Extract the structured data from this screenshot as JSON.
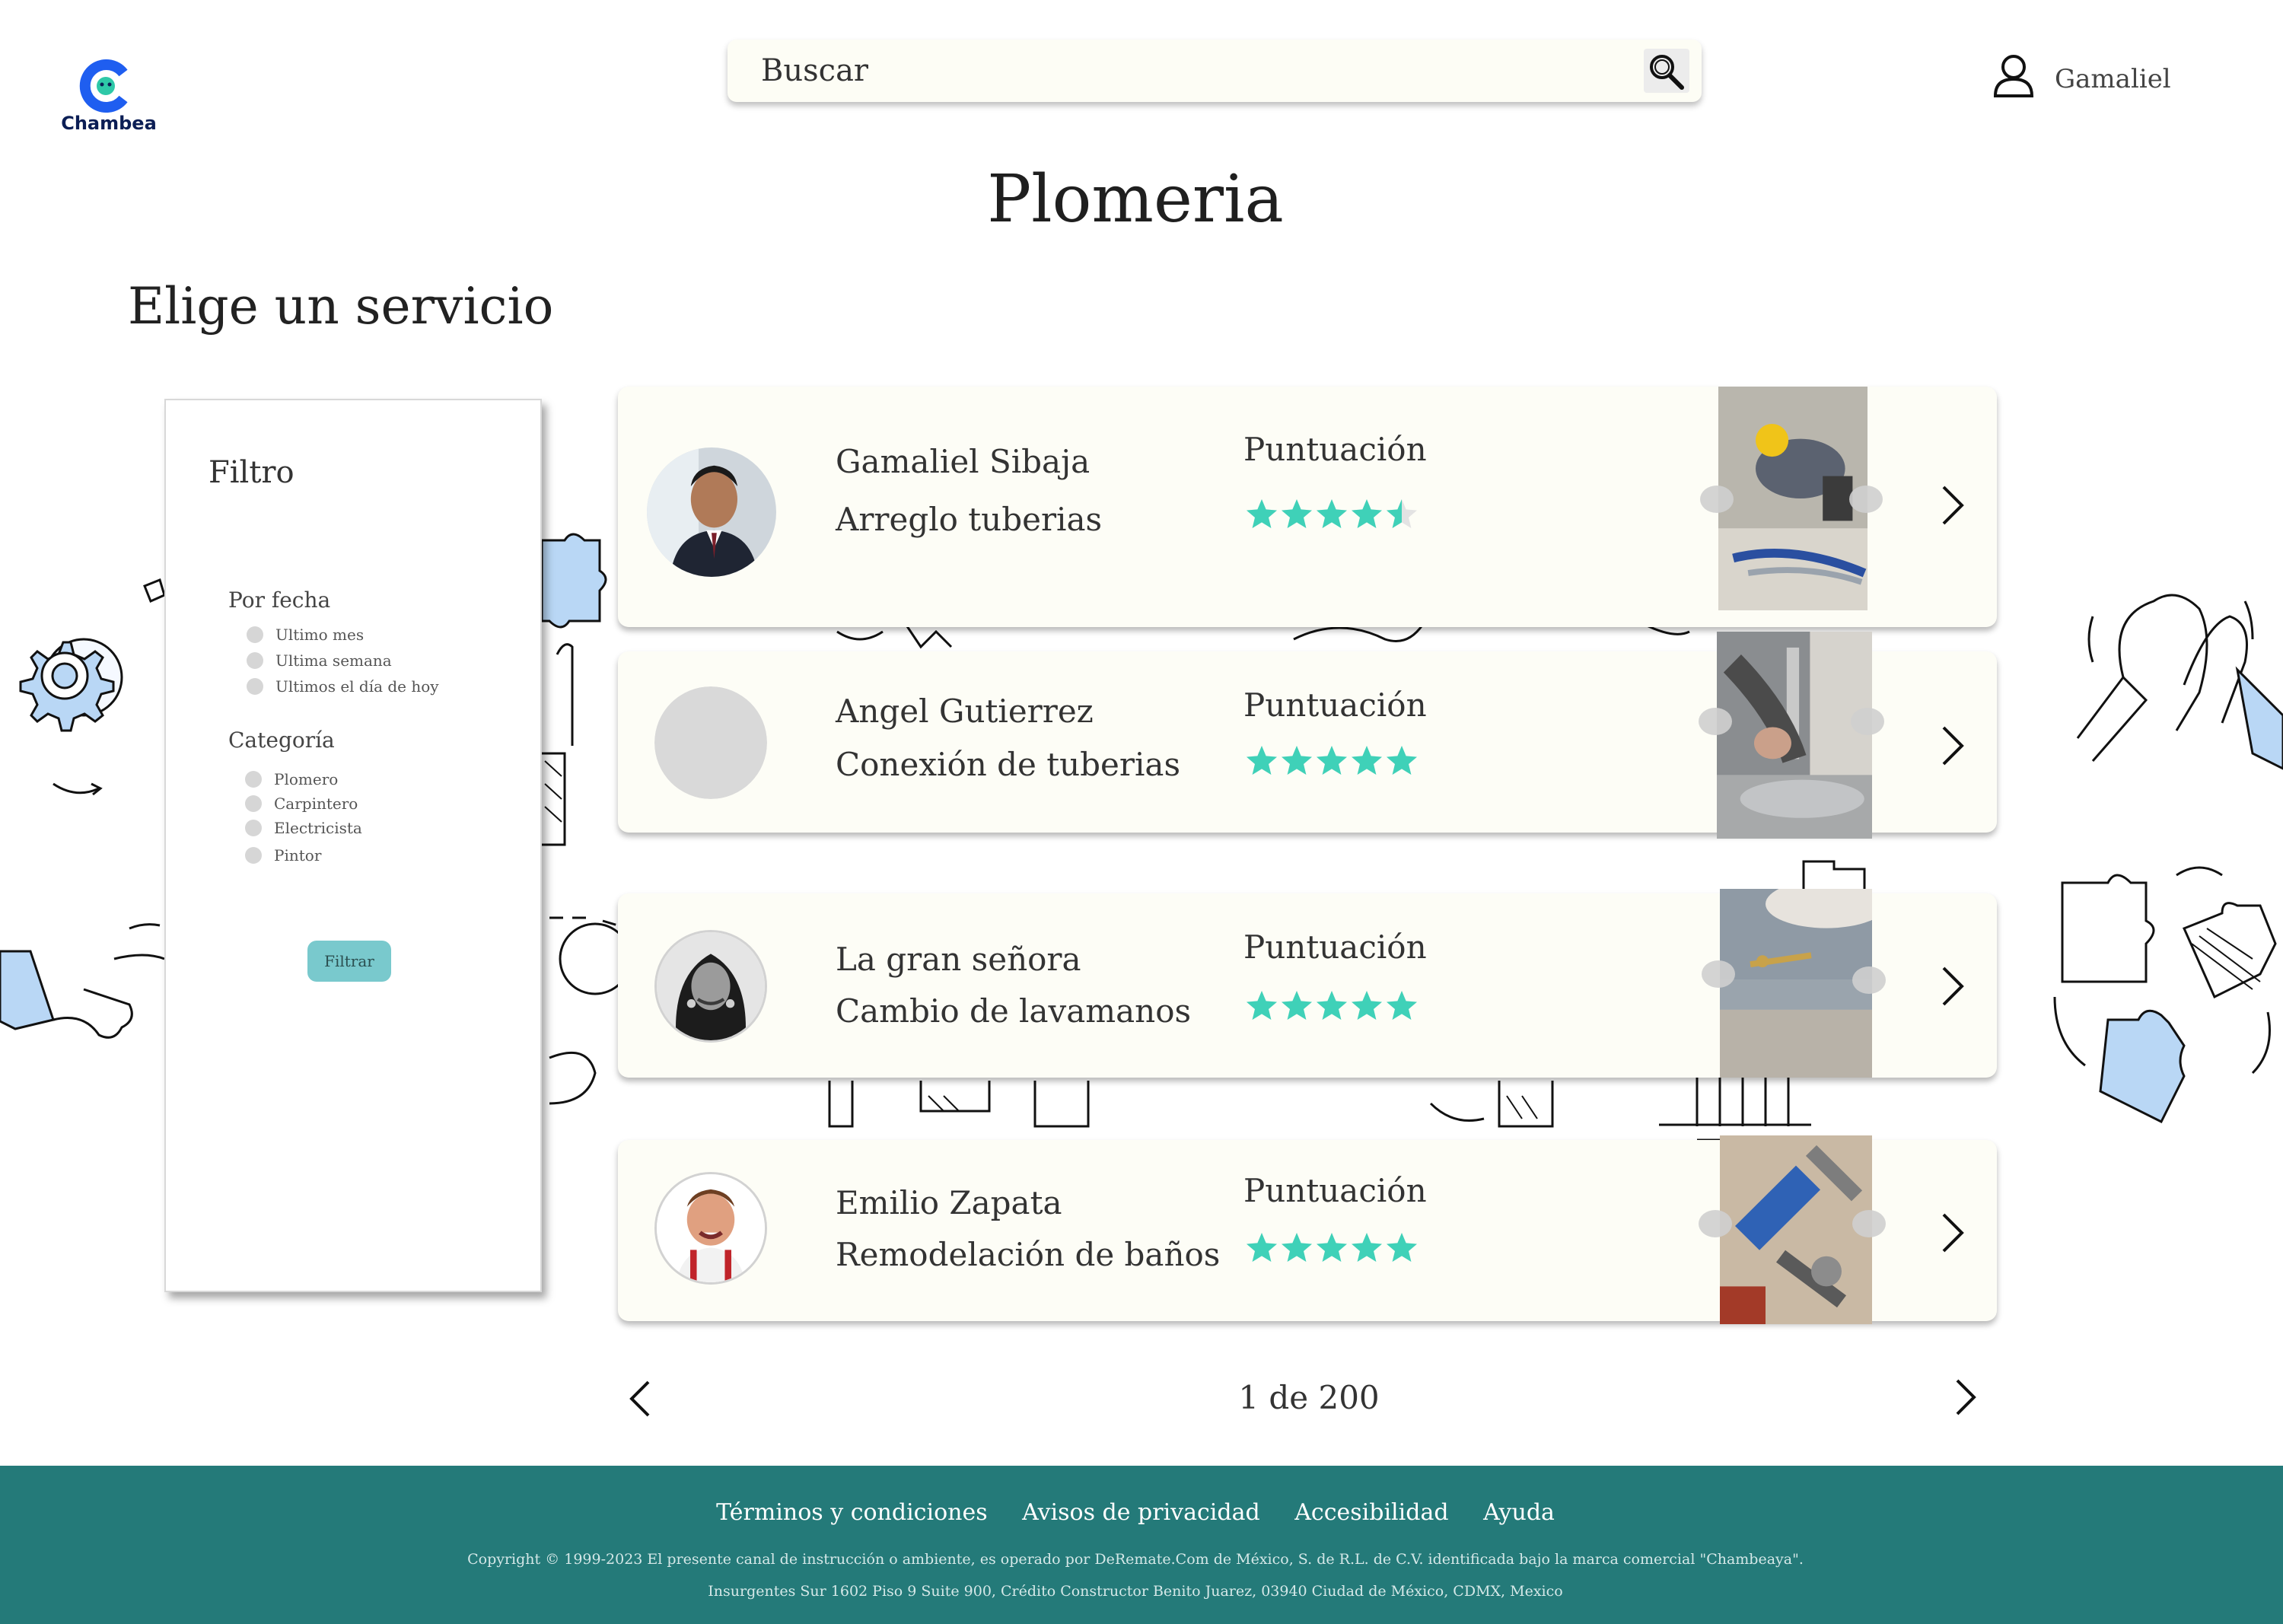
{
  "brand": {
    "logo_text": "Chambea"
  },
  "search": {
    "placeholder": "Buscar"
  },
  "user": {
    "name": "Gamaliel"
  },
  "page": {
    "title": "Plomeria",
    "subtitle": "Elige un servicio"
  },
  "filter": {
    "title": "Filtro",
    "by_date": {
      "label": "Por fecha",
      "options": [
        "Ultimo mes",
        "Ultima semana",
        "Ultimos el día de hoy"
      ]
    },
    "category": {
      "label": "Categoría",
      "options": [
        "Plomero",
        "Carpintero",
        "Electricista",
        "Pintor"
      ]
    },
    "button": "Filtrar"
  },
  "score_label": "Puntuación",
  "providers": [
    {
      "name": "Gamaliel Sibaja",
      "service": "Arreglo tuberias",
      "rating": 4.5,
      "avatar": "man-suit-photo",
      "photo": "worker-fixing-pipes-photo"
    },
    {
      "name": "Angel Gutierrez",
      "service": "Conexión de tuberias",
      "rating": 5,
      "avatar": "placeholder-avatar",
      "photo": "faucet-repair-photo"
    },
    {
      "name": "La gran señora",
      "service": "Cambio de lavamanos",
      "rating": 5,
      "avatar": "woman-bw-photo",
      "photo": "sink-underside-photo"
    },
    {
      "name": "Emilio  Zapata",
      "service": "Remodelación de baños",
      "rating": 5,
      "avatar": "smiling-man-suspenders-photo",
      "photo": "pipe-wrenches-photo"
    }
  ],
  "pagination": {
    "text": "1 de 200"
  },
  "footer": {
    "links": [
      "Términos y condiciones",
      "Avisos de privacidad",
      "Accesibilidad",
      "Ayuda"
    ],
    "copyright": "Copyright © 1999-2023 El presente canal de instrucción o ambiente, es operado por DeRemate.Com de México, S. de R.L. de C.V. identificada bajo la marca comercial \"Chambeaya\".",
    "address": "Insurgentes Sur 1602 Piso 9 Suite 900, Crédito Constructor Benito Juarez, 03940 Ciudad de México, CDMX, Mexico"
  },
  "colors": {
    "accent": "#3fd1b8",
    "footer": "#247a79",
    "filter_button": "#79c9cd",
    "card": "#fdfdf6",
    "doodle_blue": "#b9d7f5"
  }
}
